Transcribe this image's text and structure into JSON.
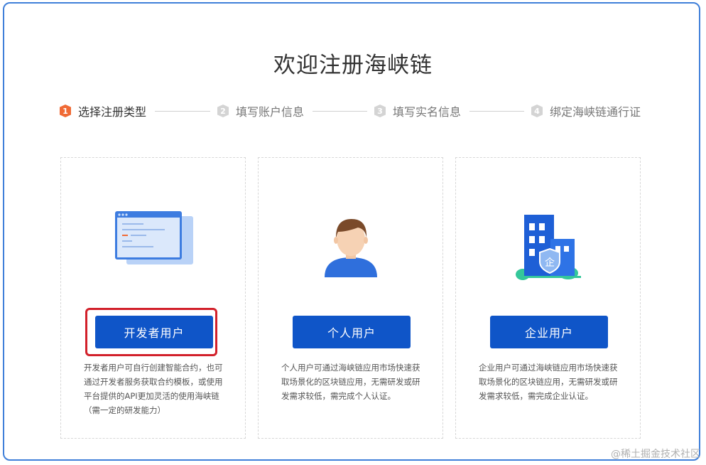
{
  "page": {
    "title": "欢迎注册海峡链"
  },
  "steps": [
    {
      "num": "1",
      "label": "选择注册类型"
    },
    {
      "num": "2",
      "label": "填写账户信息"
    },
    {
      "num": "3",
      "label": "填写实名信息"
    },
    {
      "num": "4",
      "label": "绑定海峡链通行证"
    }
  ],
  "cards": [
    {
      "button": "开发者用户",
      "description": "开发者用户可自行创建智能合约，也可通过开发者服务获取合约模板，或使用平台提供的API更加灵活的使用海峡链（需一定的研发能力）",
      "illustration": "developer-window-icon"
    },
    {
      "button": "个人用户",
      "description": "个人用户可通过海峡链应用市场快速获取场景化的区块链应用，无需研发或研发需求较低，需完成个人认证。",
      "illustration": "person-avatar-icon"
    },
    {
      "button": "企业用户",
      "description": "企业用户可通过海峡链应用市场快速获取场景化的区块链应用，无需研发或研发需求较低，需完成企业认证。",
      "illustration": "enterprise-building-icon",
      "badge": "企"
    }
  ],
  "watermark": "@稀土掘金技术社区",
  "colors": {
    "primary_button": "#0f55c8",
    "active_step": "#f06a35",
    "inactive_step": "#d4d4d4",
    "highlight_border": "#d2202a",
    "frame_border": "#3f7fd9"
  }
}
